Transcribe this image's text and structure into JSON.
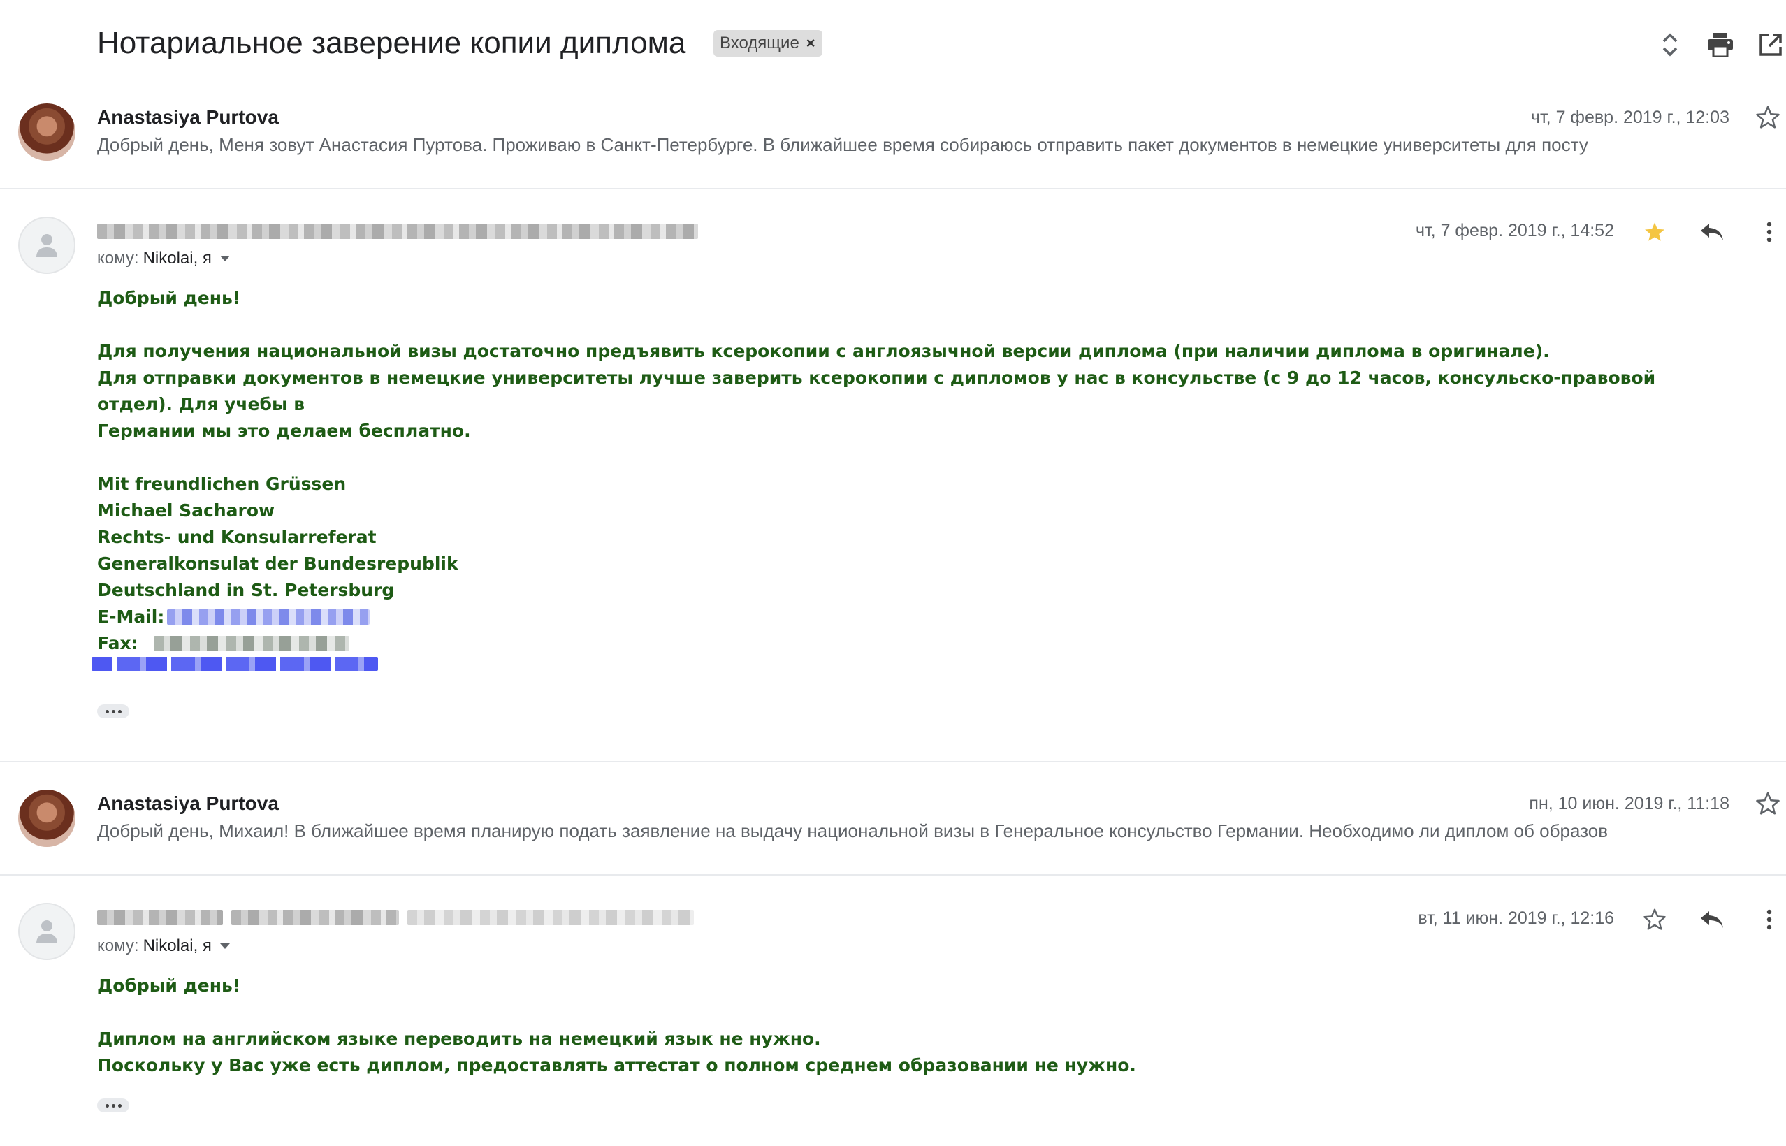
{
  "header": {
    "subject": "Нотариальное заверение копии диплома",
    "label": "Входящие",
    "label_close": "×"
  },
  "messages": [
    {
      "sender": "Anastasiya Purtova",
      "date": "чт, 7 февр. 2019 г., 12:03",
      "snippet": "Добрый день, Меня зовут Анастасия Пуртова. Проживаю в Санкт-Петербурге. В ближайшее время собираюсь отправить пакет документов в немецкие университеты для посту",
      "starred": false
    },
    {
      "date": "чт, 7 февр. 2019 г., 14:52",
      "starred": true,
      "to_prefix": "кому:",
      "to_names": "Nikolai, я",
      "body": {
        "greeting": "Добрый день!",
        "line1": "Для получения национальной визы достаточно предъявить ксерокопии с англоязычной версии диплома (при наличии диплома в оригинале).",
        "line2": "Для отправки документов в немецкие университеты лучше заверить ксерокопии с дипломов у нас в консульстве (с 9 до 12 часов, консульско-правовой отдел). Для учебы в",
        "line3": "Германии мы это делаем бесплатно.",
        "sig1": "Mit freundlichen Grüssen",
        "sig2": "Michael Sacharow",
        "sig3": "Rechts- und Konsularreferat",
        "sig4": "Generalkonsulat der Bundesrepublik",
        "sig5": "Deutschland in St. Petersburg",
        "email_label": "E-Mail:",
        "fax_label": "Fax:"
      }
    },
    {
      "sender": "Anastasiya Purtova",
      "date": "пн, 10 июн. 2019 г., 11:18",
      "snippet": "Добрый день, Михаил! В ближайшее время планирую подать заявление на выдачу национальной визы в Генеральное консульство Германии. Необходимо ли диплом об образов",
      "starred": false
    },
    {
      "date": "вт, 11 июн. 2019 г., 12:16",
      "starred": false,
      "to_prefix": "кому:",
      "to_names": "Nikolai, я",
      "body": {
        "greeting": "Добрый день!",
        "line1": "Диплом на английском языке переводить на немецкий язык не нужно.",
        "line2": "Поскольку у Вас уже есть диплом, предоставлять аттестат о полном среднем образовании не нужно."
      }
    }
  ],
  "colors": {
    "body_text": "#1e5b15",
    "star_filled": "#f4c542",
    "divider": "#e8eaed"
  },
  "icons": [
    "expand-collapse-icon",
    "print-icon",
    "open-in-new-window-icon",
    "star-icon",
    "reply-icon",
    "more-vert-icon",
    "person-icon"
  ]
}
